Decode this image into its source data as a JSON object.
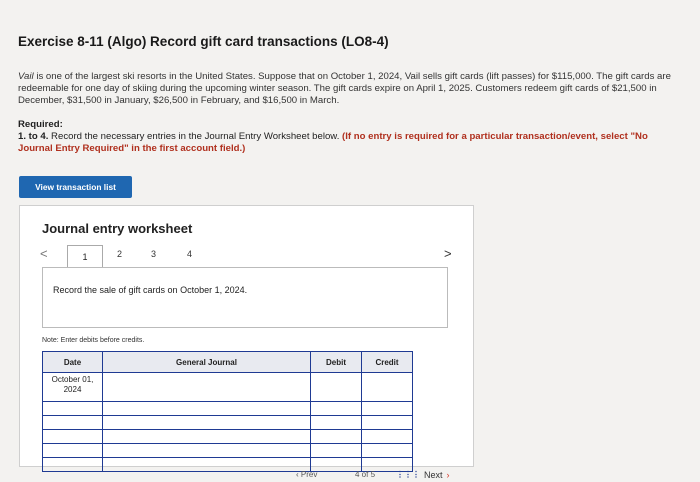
{
  "title": "Exercise 8-11 (Algo) Record gift card transactions (LO8-4)",
  "intro": {
    "company": "Vail",
    "text1": " is one of the largest ski resorts in the United States. Suppose that on October 1, 2024, Vail sells gift cards (lift passes) for $115,000. The gift cards are redeemable for one day of skiing during the upcoming winter season. The gift cards expire on April 1, 2025. Customers redeem gift cards of $21,500 in December, $31,500 in January, $26,500 in February, and $16,500 in March."
  },
  "required": {
    "heading": "Required:",
    "num": "1. to 4.",
    "text": " Record the necessary entries in the Journal Entry Worksheet below. ",
    "bold": "(If no entry is required for a particular transaction/event, select \"No Journal Entry Required\" in the first account field.)"
  },
  "view_button": "View transaction list",
  "worksheet": {
    "title": "Journal entry worksheet",
    "tabs": [
      "1",
      "2",
      "3",
      "4"
    ],
    "prev": "<",
    "next": ">",
    "description": "Record the sale of gift cards on October 1, 2024.",
    "note": "Note: Enter debits before credits.",
    "columns": [
      "Date",
      "General Journal",
      "Debit",
      "Credit"
    ],
    "rows": [
      {
        "date": "October 01, 2024"
      },
      {
        "date": ""
      },
      {
        "date": ""
      },
      {
        "date": ""
      },
      {
        "date": ""
      },
      {
        "date": ""
      }
    ]
  },
  "footer": {
    "prev": "Prev",
    "page": "4 of 5",
    "next": "Next"
  }
}
